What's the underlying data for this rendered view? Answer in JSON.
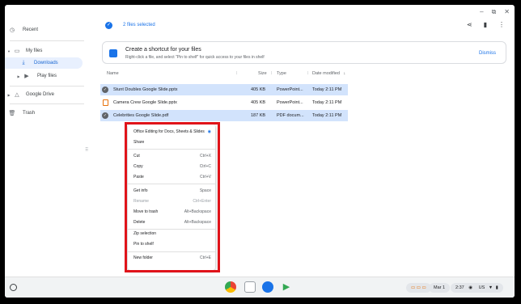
{
  "window": {
    "minimize_icon": "minimize-icon",
    "maximize_icon": "maximize-icon",
    "close_icon": "close-icon"
  },
  "sidebar": {
    "recent": "Recent",
    "my_files": "My files",
    "downloads": "Downloads",
    "play_files": "Play files",
    "google_drive": "Google Drive",
    "trash": "Trash"
  },
  "toolbar": {
    "selection": "2 files selected"
  },
  "banner": {
    "title": "Create a shortcut for your files",
    "subtitle": "Right-click a file, and select \"Pin to shelf\" for quick access to your files in shelf",
    "dismiss": "Dismiss"
  },
  "columns": {
    "name": "Name",
    "size": "Size",
    "type": "Type",
    "date": "Date modified",
    "sort_icon": "↓"
  },
  "files": [
    {
      "name": "Stunt Doubles Google Slide.pptx",
      "size": "405 KB",
      "type": "PowerPoint...",
      "date": "Today 2:11 PM",
      "selected": true
    },
    {
      "name": "Camera Crew Google Slide.pptx",
      "size": "405 KB",
      "type": "PowerPoint...",
      "date": "Today 2:11 PM",
      "selected": false
    },
    {
      "name": "Celebrities Google Slide.pdf",
      "size": "187 KB",
      "type": "PDF docum...",
      "date": "Today 2:11 PM",
      "selected": true
    }
  ],
  "context_menu": {
    "office": "Office Editing for Docs, Sheets & Slides",
    "share": "Share",
    "cut": "Cut",
    "cut_sc": "Ctrl+X",
    "copy": "Copy",
    "copy_sc": "Ctrl+C",
    "paste": "Paste",
    "paste_sc": "Ctrl+V",
    "get_info": "Get info",
    "get_info_sc": "Space",
    "rename": "Rename",
    "rename_sc": "Ctrl+Enter",
    "move_trash": "Move to trash",
    "move_trash_sc": "Alt+Backspace",
    "delete": "Delete",
    "delete_sc": "Alt+Backspace",
    "zip": "Zip selection",
    "pin": "Pin to shelf",
    "new_folder": "New folder",
    "new_folder_sc": "Ctrl+E"
  },
  "shelf": {
    "date": "Mar 1",
    "time": "2:37",
    "locale": "US"
  },
  "colors": {
    "accent": "#1a73e8",
    "highlight": "#e0131a",
    "selected_row": "#d2e3fc"
  }
}
